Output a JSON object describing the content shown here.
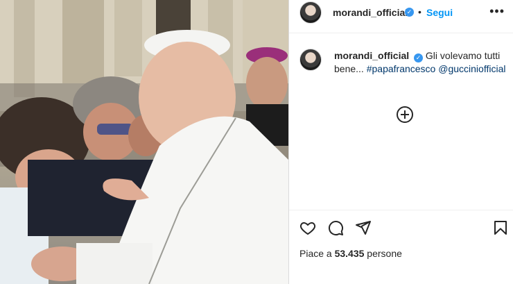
{
  "post": {
    "photo_description": "",
    "username": "morandi_official",
    "separator": "•",
    "follow_label": "Segui",
    "more_label": "•••",
    "caption": {
      "username": "morandi_official",
      "text_before": "Gli volevamo tutti bene...",
      "hashtag": "#papafrancesco",
      "mention": "@gucciniofficial"
    },
    "likes": {
      "prefix": "Piace a ",
      "count": "53.435",
      "suffix": " persone"
    }
  },
  "icons": {
    "verified": "verified-badge-icon",
    "like": "heart-icon",
    "comment": "comment-icon",
    "share": "paper-plane-icon",
    "save": "bookmark-icon",
    "add_comment": "plus-circle-icon"
  },
  "colors": {
    "accent": "#0095f6",
    "verified": "#3797f0",
    "hashtag": "#00376b",
    "text": "#262626"
  }
}
